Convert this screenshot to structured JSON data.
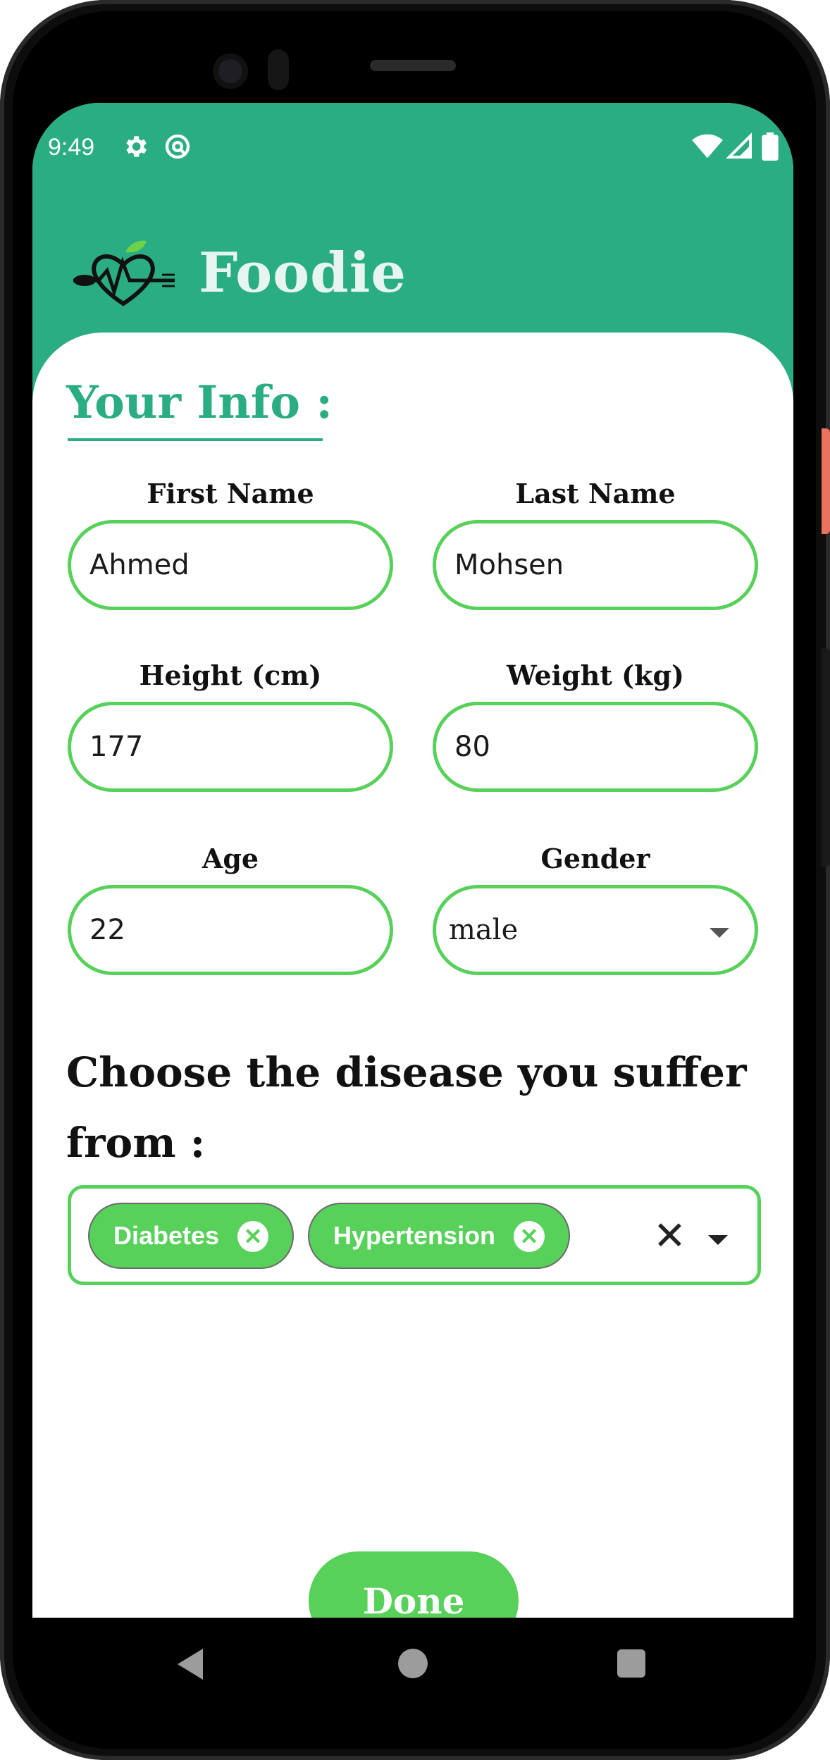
{
  "status_bar": {
    "time": "9:49",
    "icons": [
      "gear-icon",
      "at-sign-icon",
      "wifi-icon",
      "signal-icon",
      "battery-icon"
    ]
  },
  "header": {
    "logo": "heart-fork-spoon-logo",
    "app_name": "Foodie"
  },
  "form": {
    "title": "Your Info :",
    "first_name": {
      "label": "First Name",
      "value": "Ahmed"
    },
    "last_name": {
      "label": "Last Name",
      "value": "Mohsen"
    },
    "height": {
      "label": "Height (cm)",
      "value": "177"
    },
    "weight": {
      "label": "Weight (kg)",
      "value": "80"
    },
    "age": {
      "label": "Age",
      "value": "22"
    },
    "gender": {
      "label": "Gender",
      "value": "male"
    },
    "disease_question_line1": "Choose the disease you suffer",
    "disease_question_line2": "from :",
    "diseases": [
      {
        "label": "Diabetes"
      },
      {
        "label": "Hypertension"
      }
    ],
    "done_label": "Done"
  },
  "colors": {
    "header": "#2bad83",
    "accent_green": "#57d15a",
    "title_green": "#2bad83"
  },
  "nav_bar": [
    "back-icon",
    "home-icon",
    "recents-icon"
  ]
}
